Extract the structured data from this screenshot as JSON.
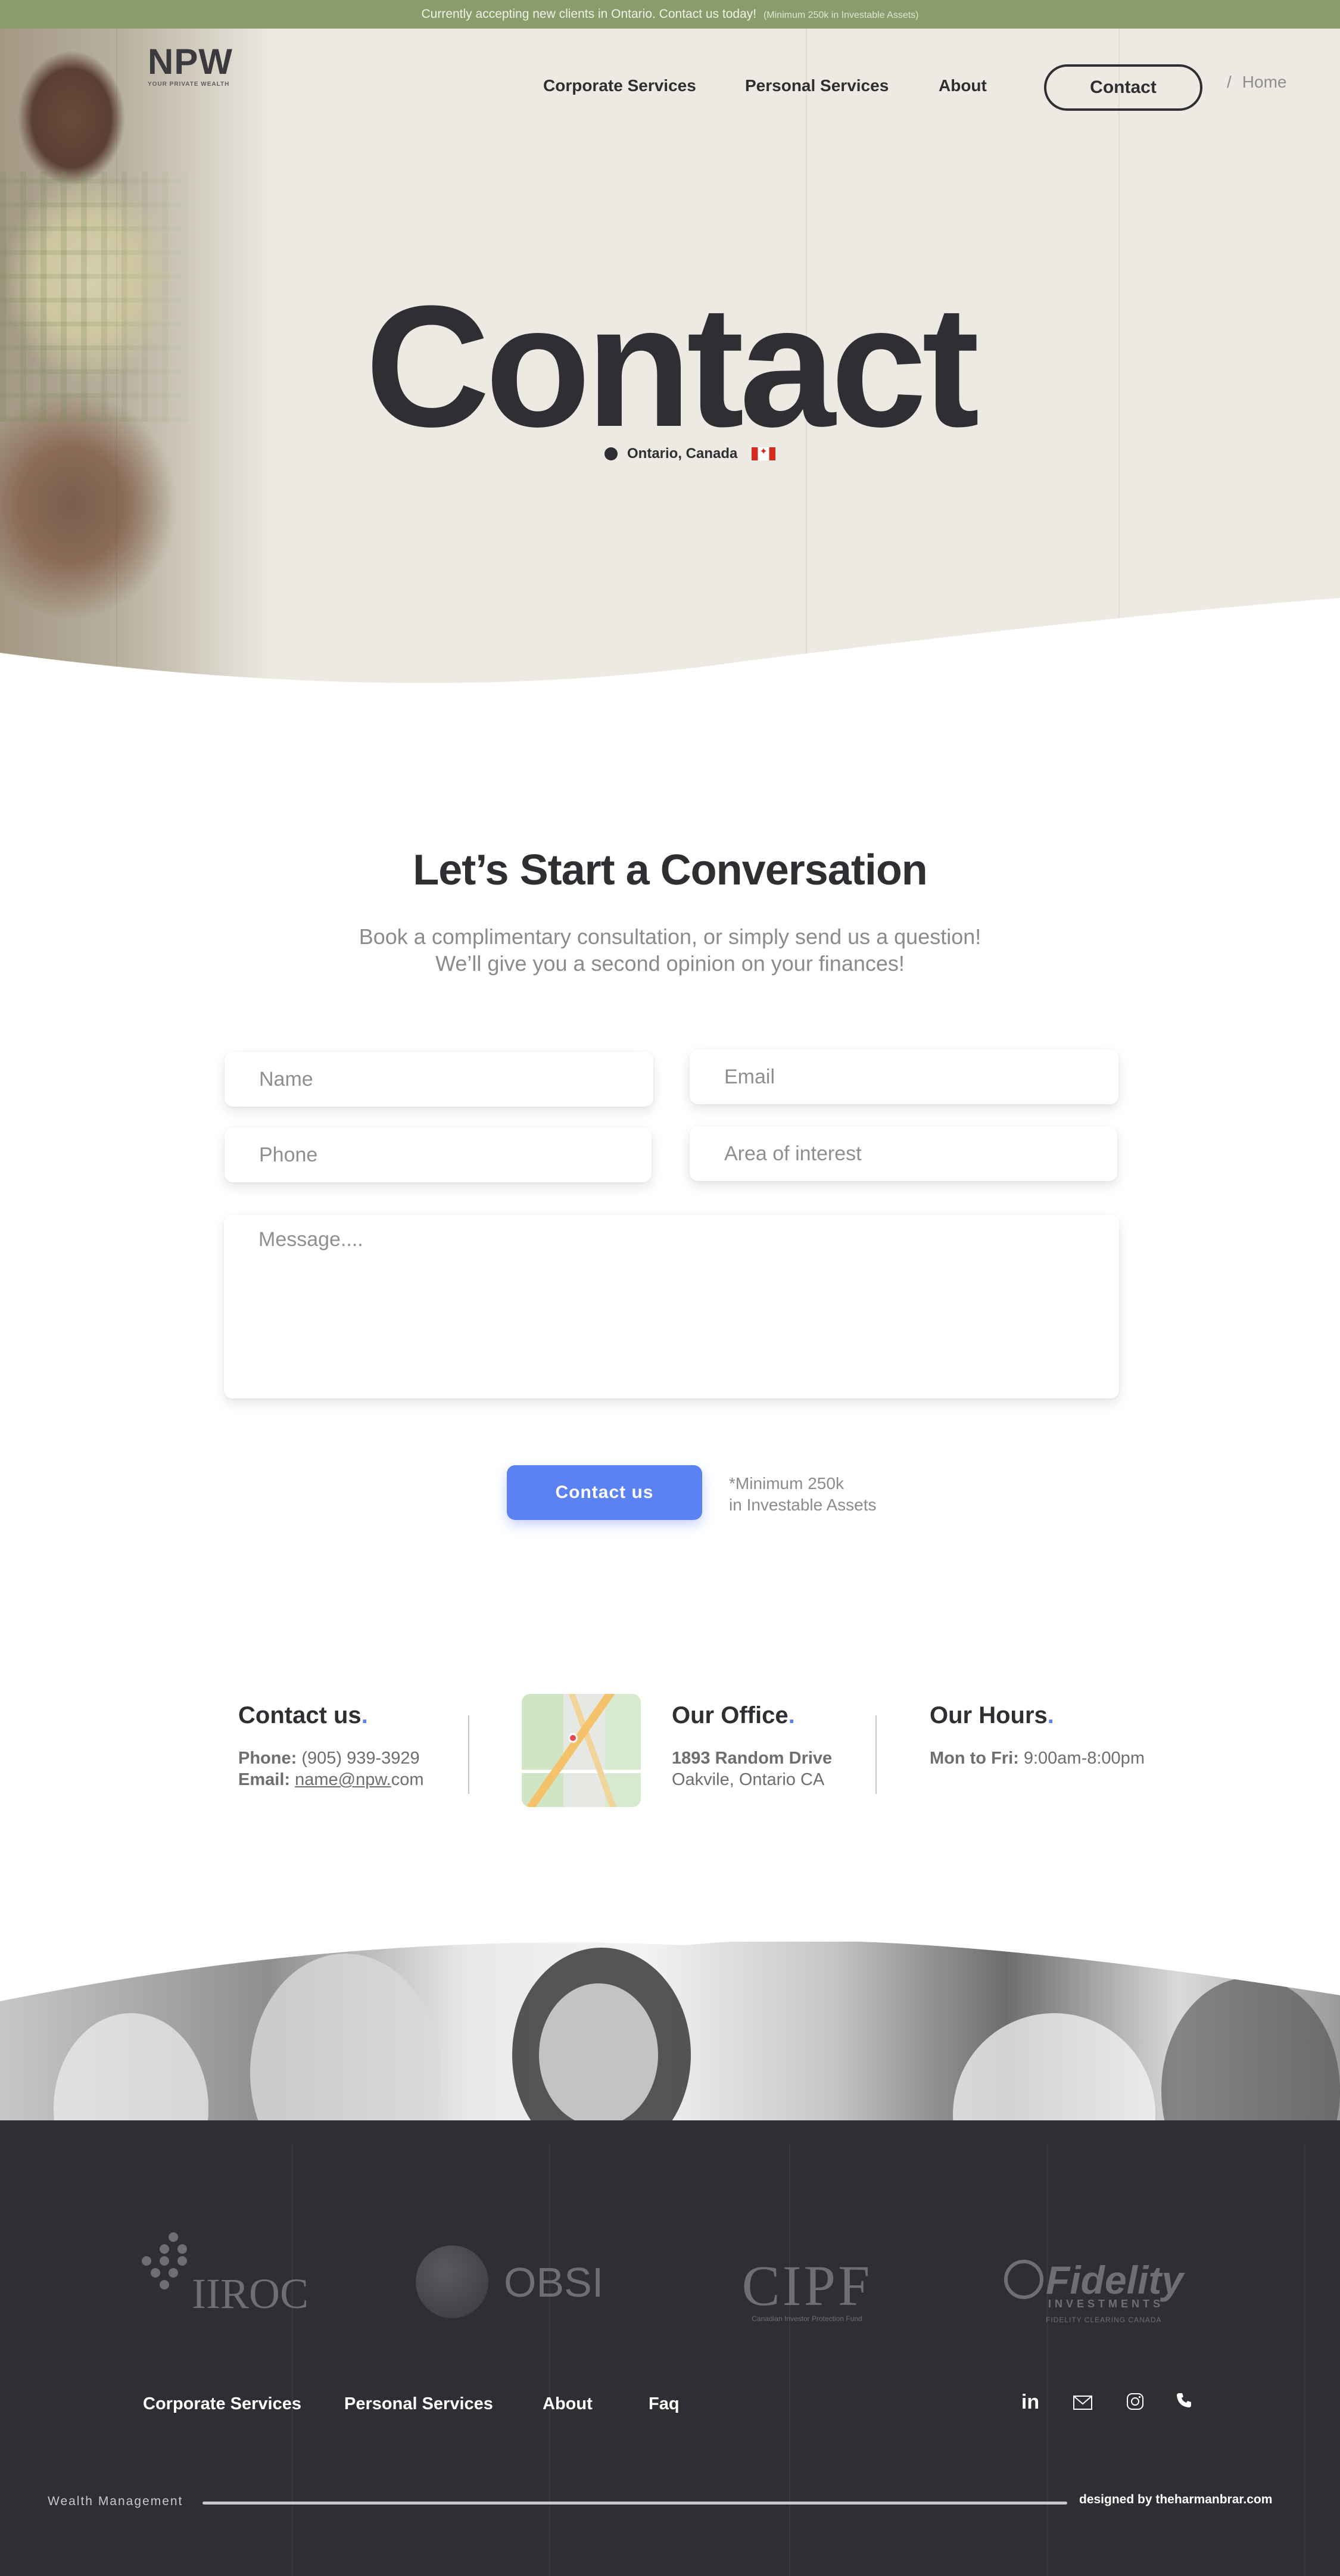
{
  "banner": {
    "text": "Currently accepting new clients in Ontario. Contact us today!",
    "note": "(Minimum 250k  in Investable Assets)"
  },
  "logo": {
    "mark": "NPW",
    "tagline": "YOUR PRIVATE WEALTH"
  },
  "nav": {
    "items": [
      "Corporate Services",
      "Personal Services",
      "About"
    ],
    "contact_button": "Contact",
    "breadcrumb_sep": "/",
    "breadcrumb": "Home"
  },
  "hero": {
    "title": "Contact",
    "location": "Ontario, Canada",
    "flag_icon": "canada-flag-icon"
  },
  "conversation": {
    "title": "Let’s Start a Conversation",
    "subtitle_1": "Book a complimentary consultation, or simply send us a question!",
    "subtitle_2": "We’ll give you a second opinion on your finances!"
  },
  "form": {
    "name_placeholder": "Name",
    "email_placeholder": "Email",
    "phone_placeholder": "Phone",
    "interest_placeholder": "Area of interest",
    "message_placeholder": "Message....",
    "submit_label": "Contact us",
    "minimum_note_1": "*Minimum 250k",
    "minimum_note_2": "in Investable Assets"
  },
  "info": {
    "contact": {
      "title": "Contact us",
      "phone_label": "Phone:",
      "phone": "(905) 939-3929",
      "email_label": "Email:",
      "email": "name@npw.",
      "email_tail": "com"
    },
    "office": {
      "title": "Our Office",
      "street": "1893 Random Drive",
      "city": "Oakvile, Ontario CA",
      "map_icon": "map-thumbnail"
    },
    "hours": {
      "title": "Our Hours",
      "days": "Mon to Fri:",
      "times": "9:00am-8:00pm"
    },
    "dot": "."
  },
  "partners": {
    "iiroc": "IIROC",
    "obsi": "OBSI",
    "cipf": "CIPF",
    "cipf_sub": "Canadian Investor Protection Fund",
    "fidelity": "Fidelity",
    "fidelity_sub_1": "INVESTMENTS",
    "fidelity_sub_2": "FIDELITY CLEARING CANADA"
  },
  "footer": {
    "nav": [
      "Corporate Services",
      "Personal Services",
      "About",
      "Faq"
    ],
    "social": {
      "linkedin": "in",
      "email_icon": "mail-icon",
      "instagram_icon": "instagram-icon",
      "phone_icon": "phone-icon"
    },
    "tagline": "Wealth Management",
    "credit": "designed by theharmanbrar.com"
  },
  "colors": {
    "banner": "#8a9c6b",
    "accent": "#5b82f2",
    "dark": "#2f2e33",
    "hero_bg": "#eceae2"
  }
}
